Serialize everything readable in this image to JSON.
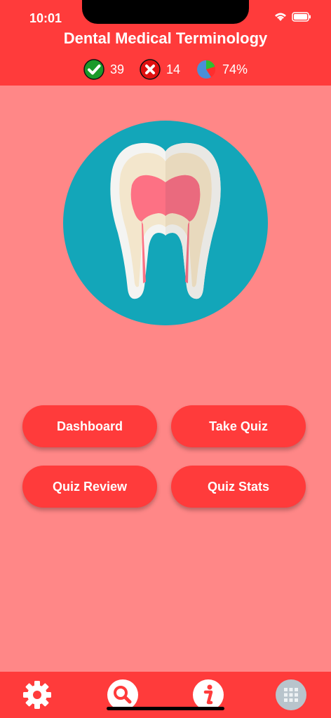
{
  "status_bar": {
    "time": "10:01"
  },
  "header": {
    "title": "Dental Medical Terminology"
  },
  "stats": {
    "correct": "39",
    "incorrect": "14",
    "score": "74%"
  },
  "buttons": {
    "dashboard": "Dashboard",
    "take_quiz": "Take Quiz",
    "quiz_review": "Quiz Review",
    "quiz_stats": "Quiz Stats"
  },
  "tabs": [
    "gear-icon",
    "search-icon",
    "info-icon",
    "grid-icon"
  ],
  "colors": {
    "header": "#ff3b3b",
    "background": "#ff8787",
    "hero_circle": "#13a6b9"
  }
}
